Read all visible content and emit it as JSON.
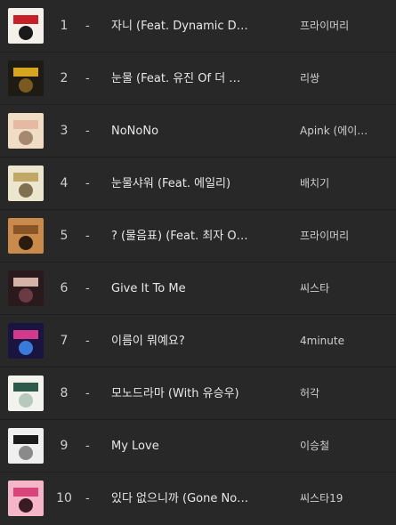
{
  "chart": {
    "rows": [
      {
        "rank": "1",
        "change": "-",
        "title": "자니 (Feat. Dynamic D…",
        "artist": "프라이머리",
        "art": "album-art-primary-johnny",
        "colors": [
          "#f4f1ea",
          "#c8202a",
          "#1a1a1a"
        ]
      },
      {
        "rank": "2",
        "change": "-",
        "title": "눈물 (Feat. 유진 Of 더 …",
        "artist": "리쌍",
        "art": "album-art-leessang",
        "colors": [
          "#1e1a14",
          "#d7a51e",
          "#7a5a20"
        ]
      },
      {
        "rank": "3",
        "change": "-",
        "title": "NoNoNo",
        "artist": "Apink (에이…",
        "artist_full": "Apink (에이…",
        "art": "album-art-apink",
        "colors": [
          "#f1dcc6",
          "#e6b9a2",
          "#a48870"
        ]
      },
      {
        "rank": "4",
        "change": "-",
        "title": "눈물샤워 (Feat. 에일리)",
        "artist": "배치기",
        "art": "album-art-baechigi",
        "colors": [
          "#ede6cf",
          "#c2a866",
          "#7e7050"
        ]
      },
      {
        "rank": "5",
        "change": "-",
        "title": "? (물음표) (Feat. 최자 O…",
        "artist": "프라이머리",
        "art": "album-art-primary-question",
        "colors": [
          "#c98a4c",
          "#8a5526",
          "#2b1a0e"
        ]
      },
      {
        "rank": "6",
        "change": "-",
        "title": "Give It To Me",
        "artist": "씨스타",
        "art": "album-art-sistar",
        "colors": [
          "#2a1a1e",
          "#d6b3a8",
          "#6b3a44"
        ]
      },
      {
        "rank": "7",
        "change": "-",
        "title": "이름이 뭐예요?",
        "artist": "4minute",
        "art": "album-art-4minute",
        "colors": [
          "#1a1440",
          "#d43a8c",
          "#3a7ad8"
        ]
      },
      {
        "rank": "8",
        "change": "-",
        "title": "모노드라마 (With 유승우)",
        "artist": "허각",
        "art": "album-art-huhgak",
        "colors": [
          "#f2f2ee",
          "#2d5a4a",
          "#b7c9bd"
        ]
      },
      {
        "rank": "9",
        "change": "-",
        "title": "My Love",
        "artist": "이승철",
        "art": "album-art-leeseungchul",
        "colors": [
          "#efefef",
          "#1a1a1a",
          "#8a8a8a"
        ]
      },
      {
        "rank": "10",
        "change": "-",
        "title": "있다 없으니까 (Gone No…",
        "artist": "씨스타19",
        "art": "album-art-sistar19",
        "colors": [
          "#f4b6c8",
          "#d8457a",
          "#3a1a24"
        ]
      }
    ]
  }
}
